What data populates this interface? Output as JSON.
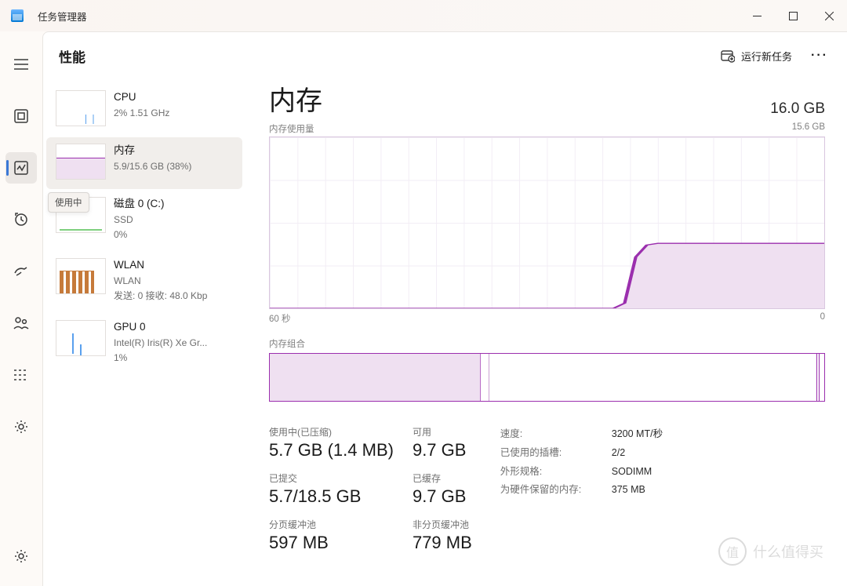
{
  "app": {
    "title": "任务管理器"
  },
  "header": {
    "title": "性能",
    "run_task": "运行新任务"
  },
  "tooltip": "使用中",
  "sidebar": {
    "items": [
      {
        "name": "CPU",
        "sub": "2%  1.51 GHz"
      },
      {
        "name": "内存",
        "sub": "5.9/15.6 GB (38%)"
      },
      {
        "name": "磁盘 0 (C:)",
        "sub1": "SSD",
        "sub2": "0%"
      },
      {
        "name": "WLAN",
        "sub1": "WLAN",
        "sub2": "发送: 0  接收: 48.0 Kbp"
      },
      {
        "name": "GPU 0",
        "sub1": "Intel(R) Iris(R) Xe Gr...",
        "sub2": "1%"
      }
    ]
  },
  "main": {
    "title": "内存",
    "capacity": "16.0 GB",
    "usage_label": "内存使用量",
    "usage_max": "15.6 GB",
    "xaxis_left": "60 秒",
    "xaxis_right": "0",
    "composition_label": "内存组合"
  },
  "stats": {
    "in_use": {
      "label": "使用中(已压缩)",
      "value": "5.7 GB (1.4 MB)"
    },
    "available": {
      "label": "可用",
      "value": "9.7 GB"
    },
    "committed": {
      "label": "已提交",
      "value": "5.7/18.5 GB"
    },
    "cached": {
      "label": "已缓存",
      "value": "9.7 GB"
    },
    "paged": {
      "label": "分页缓冲池",
      "value": "597 MB"
    },
    "nonpaged": {
      "label": "非分页缓冲池",
      "value": "779 MB"
    }
  },
  "details": {
    "speed": {
      "k": "速度:",
      "v": "3200 MT/秒"
    },
    "slots": {
      "k": "已使用的插槽:",
      "v": "2/2"
    },
    "form": {
      "k": "外形规格:",
      "v": "SODIMM"
    },
    "reserved": {
      "k": "为硬件保留的内存:",
      "v": "375 MB"
    }
  },
  "watermark": "什么值得买",
  "chart_data": {
    "type": "line",
    "title": "内存使用量",
    "xlabel": "秒",
    "ylabel": "GB",
    "xlim": [
      0,
      60
    ],
    "ylim": [
      0,
      15.6
    ],
    "x": [
      60,
      58,
      56,
      54,
      52,
      50,
      48,
      46,
      44,
      42,
      40,
      38,
      36,
      34,
      32,
      30,
      28,
      26,
      24,
      22,
      20,
      18,
      16,
      14,
      12,
      10,
      8,
      6,
      4,
      2,
      0
    ],
    "values": [
      0,
      0,
      0,
      0,
      0,
      0,
      0,
      0,
      0,
      0,
      0,
      0,
      0,
      0,
      0,
      0,
      0,
      0,
      0,
      0,
      0,
      0,
      0,
      0.6,
      4.8,
      5.8,
      5.9,
      5.9,
      5.9,
      5.9,
      5.9
    ]
  },
  "composition_data": {
    "type": "bar",
    "categories": [
      "in_use",
      "modified",
      "standby",
      "free",
      "reserved"
    ],
    "values_gb": [
      5.9,
      0.2,
      9.3,
      0.1,
      0.1
    ],
    "total_gb": 15.6
  }
}
